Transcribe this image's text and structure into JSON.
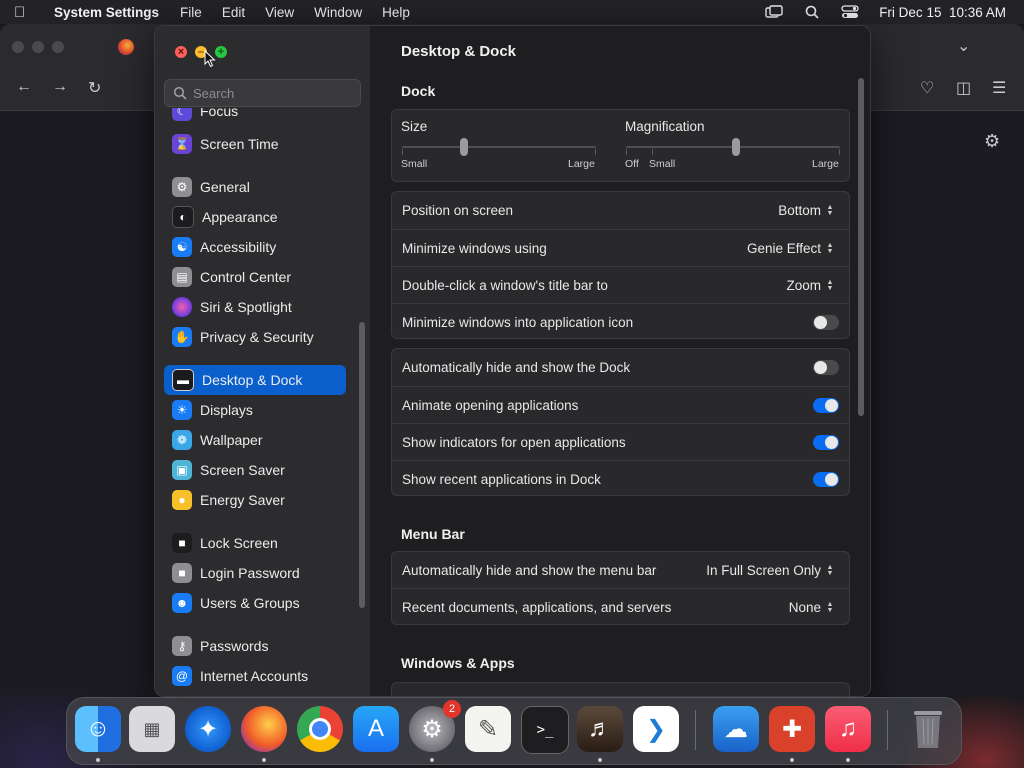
{
  "menubar": {
    "app_name": "System Settings",
    "items": [
      "File",
      "Edit",
      "View",
      "Window",
      "Help"
    ],
    "clock": "Fri Dec 15  10:36 AM"
  },
  "search": {
    "placeholder": "Search"
  },
  "sidebar": {
    "items": [
      {
        "label": "Focus",
        "icon": "moon-icon",
        "color": "#5e4ad8"
      },
      {
        "label": "Screen Time",
        "icon": "hourglass-icon",
        "color": "#6a44d6"
      },
      {
        "label": "General",
        "icon": "gear-icon",
        "color": "#8e8e93"
      },
      {
        "label": "Appearance",
        "icon": "appearance-icon",
        "color": "#1c1c1e"
      },
      {
        "label": "Accessibility",
        "icon": "accessibility-icon",
        "color": "#1a7cf5"
      },
      {
        "label": "Control Center",
        "icon": "control-center-icon",
        "color": "#8e8e93"
      },
      {
        "label": "Siri & Spotlight",
        "icon": "siri-icon",
        "color": "#c2358f"
      },
      {
        "label": "Privacy & Security",
        "icon": "hand-icon",
        "color": "#1a7cf5"
      },
      {
        "label": "Desktop & Dock",
        "icon": "dock-icon",
        "color": "#1c1c1e"
      },
      {
        "label": "Displays",
        "icon": "sun-icon",
        "color": "#1a7cf5"
      },
      {
        "label": "Wallpaper",
        "icon": "wallpaper-icon",
        "color": "#3aa7e6"
      },
      {
        "label": "Screen Saver",
        "icon": "screen-saver-icon",
        "color": "#4fb5d8"
      },
      {
        "label": "Energy Saver",
        "icon": "battery-icon",
        "color": "#f5c02a"
      },
      {
        "label": "Lock Screen",
        "icon": "lock-icon",
        "color": "#1c1c1e"
      },
      {
        "label": "Login Password",
        "icon": "password-lock-icon",
        "color": "#8e8e93"
      },
      {
        "label": "Users & Groups",
        "icon": "users-icon",
        "color": "#1a7cf5"
      },
      {
        "label": "Passwords",
        "icon": "key-icon",
        "color": "#8e8e93"
      },
      {
        "label": "Internet Accounts",
        "icon": "at-icon",
        "color": "#1a7cf5"
      }
    ]
  },
  "main": {
    "title": "Desktop & Dock",
    "dock_section": "Dock",
    "size": {
      "label": "Size",
      "min_label": "Small",
      "max_label": "Large",
      "value": 0.3
    },
    "magnification": {
      "label": "Magnification",
      "off_label": "Off",
      "min_label": "Small",
      "max_label": "Large",
      "value": 0.45
    },
    "position_on_screen": {
      "label": "Position on screen",
      "value": "Bottom"
    },
    "minimize_using": {
      "label": "Minimize windows using",
      "value": "Genie Effect"
    },
    "double_click": {
      "label": "Double-click a window's title bar to",
      "value": "Zoom"
    },
    "minimize_into_icon": {
      "label": "Minimize windows into application icon",
      "on": false
    },
    "autohide_dock": {
      "label": "Automatically hide and show the Dock",
      "on": false
    },
    "animate_opening": {
      "label": "Animate opening applications",
      "on": true
    },
    "show_indicators": {
      "label": "Show indicators for open applications",
      "on": true
    },
    "show_recent": {
      "label": "Show recent applications in Dock",
      "on": true
    },
    "menubar_section": "Menu Bar",
    "autohide_menubar": {
      "label": "Automatically hide and show the menu bar",
      "value": "In Full Screen Only"
    },
    "recent_docs": {
      "label": "Recent documents, applications, and servers",
      "value": "None"
    },
    "windows_section": "Windows & Apps"
  },
  "dock": {
    "apps": [
      {
        "name": "finder-icon",
        "color": "#2f8df5"
      },
      {
        "name": "launchpad-icon",
        "color": "#e0e0e4"
      },
      {
        "name": "safari-icon",
        "color": "#1f7ff0"
      },
      {
        "name": "firefox-icon",
        "color": "#7b2fc9"
      },
      {
        "name": "chrome-icon",
        "color": "#ffffff"
      },
      {
        "name": "app-store-icon",
        "color": "#1b8df3"
      },
      {
        "name": "system-settings-icon",
        "color": "#8a8a90",
        "badge": "2"
      },
      {
        "name": "textedit-icon",
        "color": "#f4f4f0"
      },
      {
        "name": "terminal-icon",
        "color": "#1e1e20"
      },
      {
        "name": "garageband-icon",
        "color": "#3a3a3a"
      },
      {
        "name": "vscode-icon",
        "color": "#ffffff"
      },
      {
        "name": "weather-icon",
        "color": "#2a7fd6"
      },
      {
        "name": "remote-desktop-icon",
        "color": "#d9412b"
      },
      {
        "name": "music-icon",
        "color": "#f2314e"
      },
      {
        "name": "trash-icon",
        "color": "#3a3a40"
      }
    ]
  }
}
